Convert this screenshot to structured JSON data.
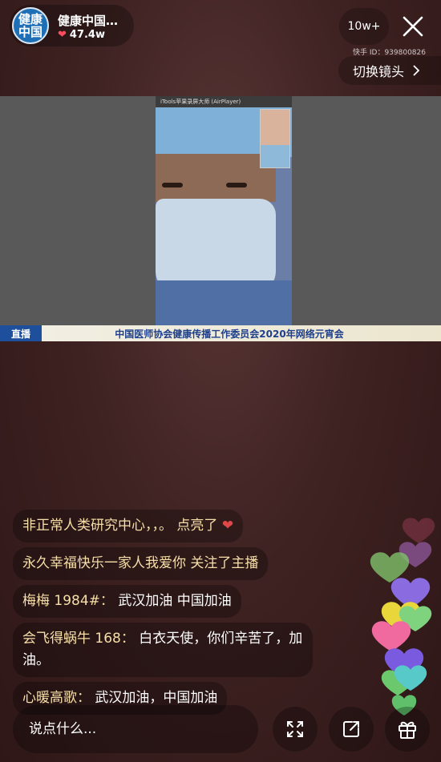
{
  "host": {
    "avatar_text_line1": "健康",
    "avatar_text_line2": "中国",
    "name": "健康中国…",
    "likes": "47.4w"
  },
  "viewers": "10w+",
  "kuaishou_id": "快手 ID：939800826",
  "switch_camera": "切换镜头",
  "video": {
    "phone_app_title": "iTools苹果录屏大师 (AirPlayer)"
  },
  "ticker": {
    "live_tag": "直播",
    "text": "中国医师协会健康传播工作委员会2020年网络元宵会"
  },
  "comments": [
    {
      "user": "非正常人类研究中心，，。",
      "message": "点亮了"
    },
    {
      "user": "永久幸福快乐一家人我爱你",
      "message": "关注了主播"
    },
    {
      "user": "梅梅 1984#：",
      "message": "武汉加油 中国加油"
    },
    {
      "user": "会飞得蜗牛 168：",
      "message": "白衣天使，你们辛苦了，加油。"
    },
    {
      "user": "心暖高歌：",
      "message": "武汉加油，中国加油"
    }
  ],
  "input": {
    "placeholder": "说点什么..."
  },
  "colors": {
    "username": "#f7dfa9",
    "heart": "#e04848",
    "accent_blue": "#1d4f9c"
  }
}
